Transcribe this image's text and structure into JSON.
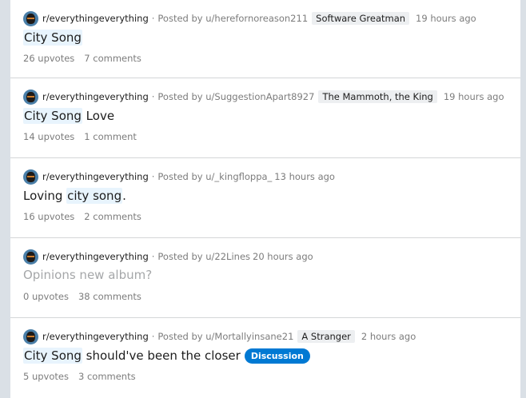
{
  "posts": [
    {
      "subreddit": "r/everythingeverything",
      "posted_by": "Posted by u/herefornoreason211",
      "flair": "Software Greatman",
      "time": "19 hours ago",
      "title_hl": "City Song",
      "title_rest": "",
      "upvotes": "26 upvotes",
      "comments": "7 comments"
    },
    {
      "subreddit": "r/everythingeverything",
      "posted_by": "Posted by u/SuggestionApart8927",
      "flair": "The Mammoth, the King",
      "time": "19 hours ago",
      "title_hl": "City Song",
      "title_rest": " Love",
      "upvotes": "14 upvotes",
      "comments": "1 comment"
    },
    {
      "subreddit": "r/everythingeverything",
      "posted_by": "Posted by u/_kingfloppa_",
      "time": "13 hours ago",
      "title_pre": "Loving ",
      "title_hl": "city song",
      "title_rest": ".",
      "upvotes": "16 upvotes",
      "comments": "2 comments"
    },
    {
      "subreddit": "r/everythingeverything",
      "posted_by": "Posted by u/22Lines",
      "time": "20 hours ago",
      "title": "Opinions new album?",
      "upvotes": "0 upvotes",
      "comments": "38 comments"
    },
    {
      "subreddit": "r/everythingeverything",
      "posted_by": "Posted by u/Mortallyinsane21",
      "flair": "A Stranger",
      "time": "2 hours ago",
      "title_hl": "City Song",
      "title_rest": " should've been the closer",
      "tag": "Discussion",
      "upvotes": "5 upvotes",
      "comments": "3 comments"
    }
  ],
  "separator": "·",
  "colors": {
    "tag_bg": "#0079d3",
    "highlight": "#e8f4fd"
  }
}
